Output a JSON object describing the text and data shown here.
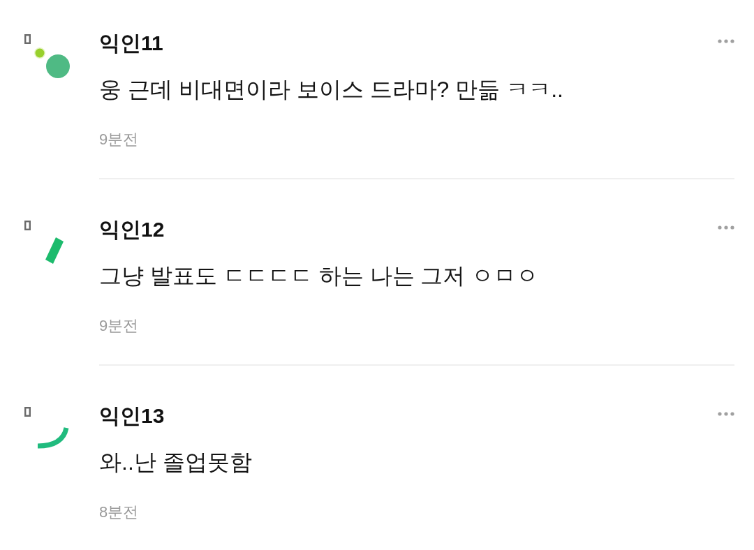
{
  "comments": [
    {
      "author": "익인11",
      "avatar": {
        "kind": "dots"
      },
      "text": "웅 근데 비대면이라 보이스 드라마? 만듦 ㅋㅋ..",
      "time": "9분전"
    },
    {
      "author": "익인12",
      "avatar": {
        "kind": "bar"
      },
      "text": "그냥 발표도 ㄷㄷㄷㄷ 하는 나는 그저 ㅇㅁㅇ",
      "time": "9분전"
    },
    {
      "author": "익인13",
      "avatar": {
        "kind": "arc"
      },
      "text": "와..난 졸업못함",
      "time": "8분전"
    }
  ]
}
